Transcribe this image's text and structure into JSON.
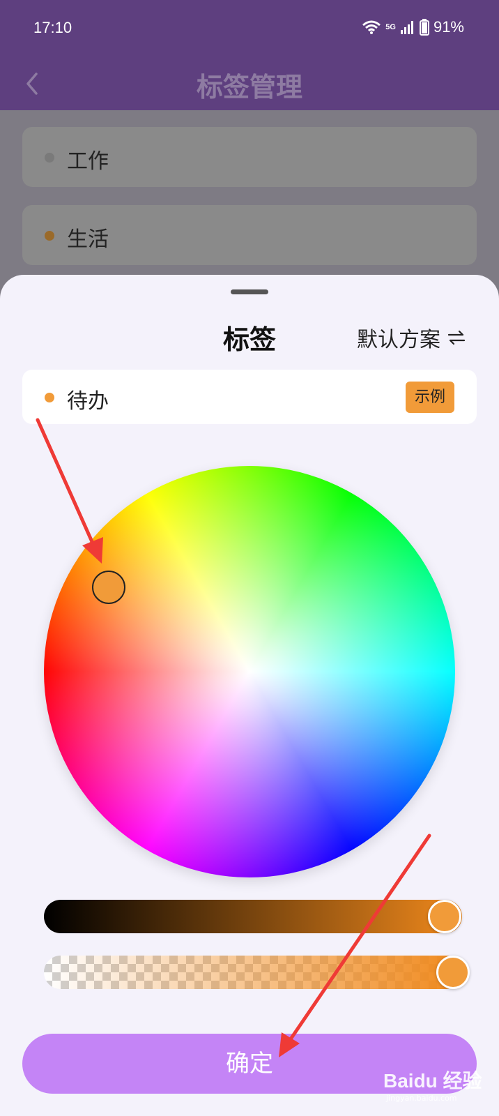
{
  "status_bar": {
    "time": "17:10",
    "network": "5G",
    "battery": "91%"
  },
  "header": {
    "title": "标签管理"
  },
  "tag_list": [
    {
      "label": "工作",
      "dot_color": "#7a7a7a"
    },
    {
      "label": "生活",
      "dot_color": "#9a6a2a"
    }
  ],
  "sheet": {
    "title": "标签",
    "scheme_label": "默认方案",
    "preview": {
      "name": "待办",
      "example_label": "示例",
      "color": "#f19b39"
    },
    "brightness": 1.0,
    "opacity": 1.0,
    "confirm_label": "确定"
  },
  "watermark": {
    "brand": "Baidu 经验",
    "sub": "jingyan.baidu.com"
  },
  "colors": {
    "accent": "#c484f6",
    "header": "#5e3f7f",
    "selected": "#f19b39",
    "annotation_arrow": "#ef3a36"
  }
}
